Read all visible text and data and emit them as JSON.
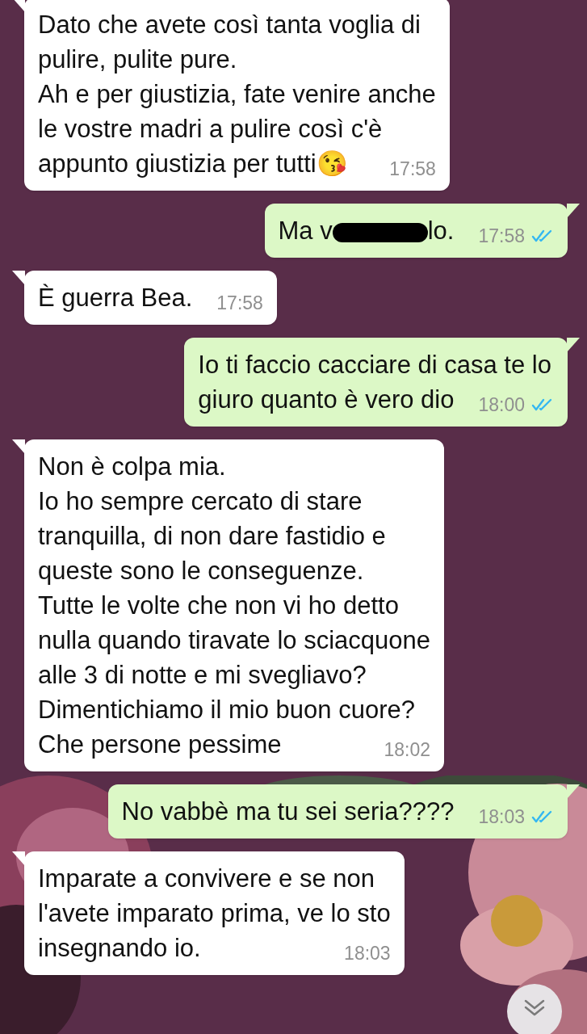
{
  "messages": [
    {
      "kind": "in",
      "text": "Dato che avete così tanta voglia di\npulire, pulite pure.\nAh e per giustizia, fate venire anche\nle vostre madri a pulire così c'è\nappunto giustizia per tutti😘",
      "time": "17:58"
    },
    {
      "kind": "out",
      "text": "Ma v",
      "redacted": true,
      "text_after": "lo.",
      "time": "17:58",
      "read": true
    },
    {
      "kind": "in",
      "text": "È guerra Bea.",
      "time": "17:58"
    },
    {
      "kind": "out",
      "text": "Io ti faccio cacciare di casa te lo\ngiuro quanto è vero dio",
      "time": "18:00",
      "read": true
    },
    {
      "kind": "in",
      "text": "Non è colpa mia.\nIo ho sempre cercato di stare\ntranquilla, di non dare fastidio e\nqueste sono le conseguenze.\nTutte le volte che non vi ho detto\nnulla quando tiravate lo sciacquone\nalle 3 di notte e mi svegliavo?\nDimentichiamo il mio buon cuore?\nChe persone pessime",
      "time": "18:02"
    },
    {
      "kind": "out",
      "text": "No vabbè ma tu sei seria????",
      "time": "18:03",
      "read": true
    },
    {
      "kind": "in",
      "text": "Imparate a convivere e se non\nl'avete imparato prima, ve lo sto\ninsegnando io.",
      "time": "18:03"
    }
  ]
}
